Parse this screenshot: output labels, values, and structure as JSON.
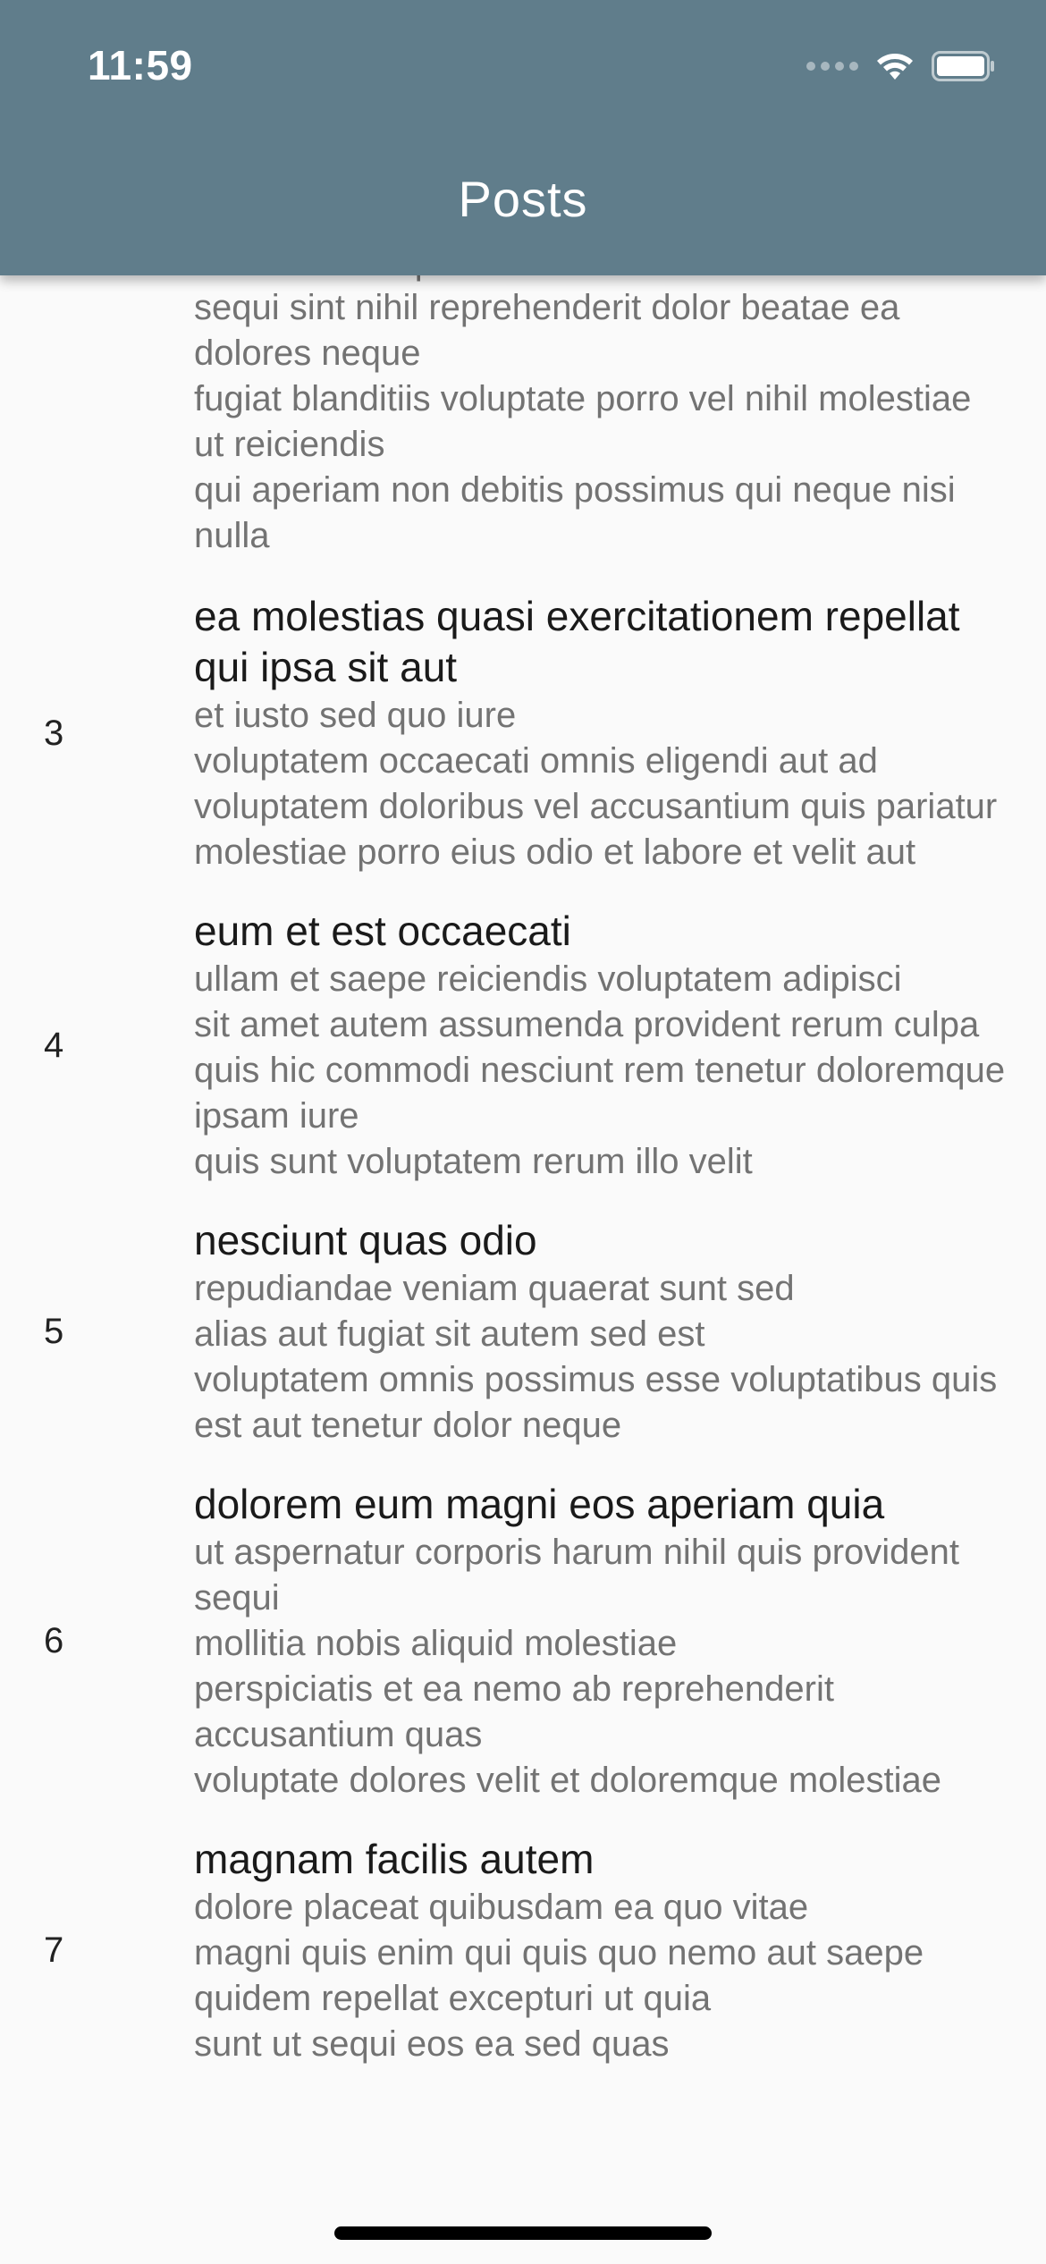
{
  "status_bar": {
    "time": "11:59"
  },
  "app_bar": {
    "title": "Posts",
    "background": "#607d8b"
  },
  "posts": [
    {
      "id": "",
      "title": "",
      "body": "est rerum tempore vitae\nsequi sint nihil reprehenderit dolor beatae ea dolores neque\nfugiat blanditiis voluptate porro vel nihil molestiae ut reiciendis\nqui aperiam non debitis possimus qui neque nisi nulla"
    },
    {
      "id": "3",
      "title": "ea molestias quasi exercitationem repellat qui ipsa sit aut",
      "body": "et iusto sed quo iure\nvoluptatem occaecati omnis eligendi aut ad\nvoluptatem doloribus vel accusantium quis pariatur\nmolestiae porro eius odio et labore et velit aut"
    },
    {
      "id": "4",
      "title": "eum et est occaecati",
      "body": "ullam et saepe reiciendis voluptatem adipisci\nsit amet autem assumenda provident rerum culpa\nquis hic commodi nesciunt rem tenetur doloremque ipsam iure\nquis sunt voluptatem rerum illo velit"
    },
    {
      "id": "5",
      "title": "nesciunt quas odio",
      "body": "repudiandae veniam quaerat sunt sed\nalias aut fugiat sit autem sed est\nvoluptatem omnis possimus esse voluptatibus quis\nest aut tenetur dolor neque"
    },
    {
      "id": "6",
      "title": "dolorem eum magni eos aperiam quia",
      "body": "ut aspernatur corporis harum nihil quis provident sequi\nmollitia nobis aliquid molestiae\nperspiciatis et ea nemo ab reprehenderit accusantium quas\nvoluptate dolores velit et doloremque molestiae"
    },
    {
      "id": "7",
      "title": "magnam facilis autem",
      "body": "dolore placeat quibusdam ea quo vitae\nmagni quis enim qui quis quo nemo aut saepe\nquidem repellat excepturi ut quia\nsunt ut sequi eos ea sed quas"
    }
  ]
}
